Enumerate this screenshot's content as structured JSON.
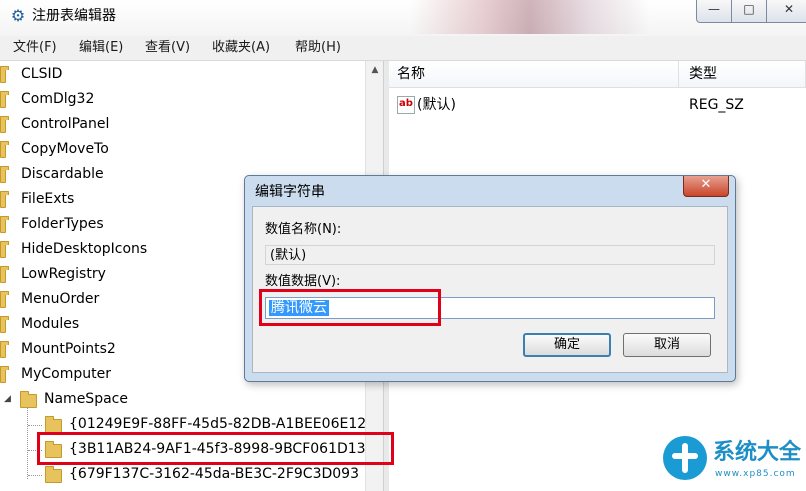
{
  "window": {
    "title": "注册表编辑器",
    "min_glyph": "—",
    "max_glyph": "□",
    "close_glyph": "✕"
  },
  "menu": [
    "文件(F)",
    "编辑(E)",
    "查看(V)",
    "收藏夹(A)",
    "帮助(H)"
  ],
  "tree": {
    "items": [
      "CLSID",
      "ComDlg32",
      "ControlPanel",
      "CopyMoveTo",
      "Discardable",
      "FileExts",
      "FolderTypes",
      "HideDesktopIcons",
      "LowRegistry",
      "MenuOrder",
      "Modules",
      "MountPoints2",
      "MyComputer"
    ],
    "namespace": "NameSpace",
    "subitems": [
      "{01249E9F-88FF-45d5-82DB-A1BEE06E12",
      "{3B11AB24-9AF1-45f3-8998-9BCF061D13",
      "{679F137C-3162-45da-BE3C-2F9C3D093"
    ],
    "selected_subitem_index": 1
  },
  "list": {
    "headers": {
      "name": "名称",
      "type": "类型"
    },
    "rows": [
      {
        "name": "(默认)",
        "type": "REG_SZ"
      }
    ]
  },
  "dialog": {
    "title": "编辑字符串",
    "close_glyph": "✕",
    "name_label": "数值名称(N):",
    "name_value": "(默认)",
    "data_label": "数值数据(V):",
    "data_value": "腾讯微云",
    "ok_label": "确定",
    "cancel_label": "取消"
  },
  "watermark": {
    "text": "系统大全",
    "url": "www.xp85.com"
  },
  "colors": {
    "highlight": "#e0001a",
    "selection": "#3399ff",
    "dialog_frame": "#cbdcee"
  }
}
